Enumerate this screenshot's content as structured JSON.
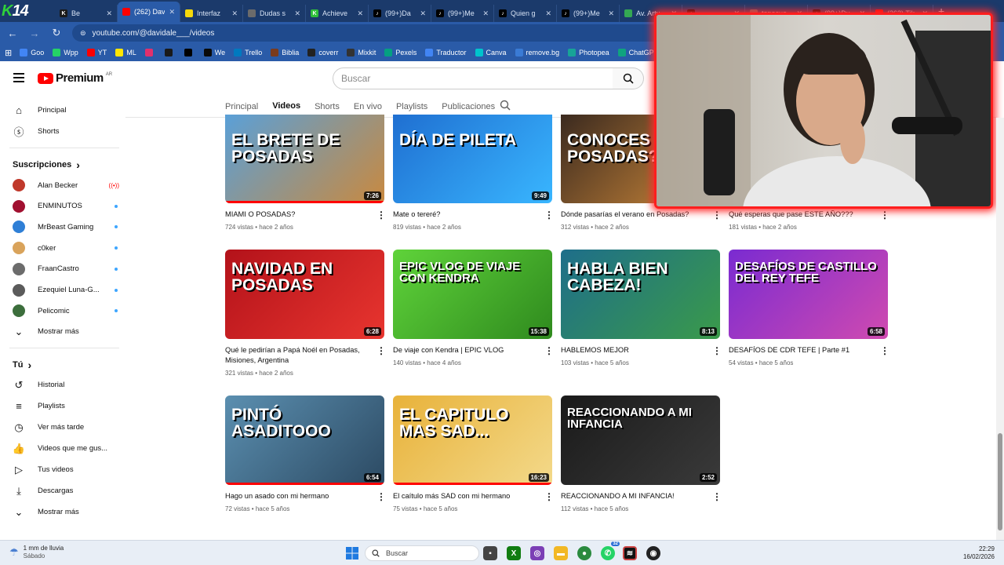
{
  "browser": {
    "tabs": [
      {
        "label": "Be",
        "fav_color": "#1a1a1a",
        "fav_text": "K"
      },
      {
        "label": "(262) Dav",
        "fav_color": "#ff0000",
        "fav_text": "",
        "active": true
      },
      {
        "label": "Interfaz",
        "fav_color": "#f5d90a",
        "fav_text": ""
      },
      {
        "label": "Dudas s",
        "fav_color": "#6b6b6b",
        "fav_text": ""
      },
      {
        "label": "Achieve",
        "fav_color": "#2fbf3a",
        "fav_text": "K"
      },
      {
        "label": "(99+)Da",
        "fav_color": "#000000",
        "fav_text": "♪"
      },
      {
        "label": "(99+)Me",
        "fav_color": "#000000",
        "fav_text": "♪"
      },
      {
        "label": "Quien g",
        "fav_color": "#000000",
        "fav_text": "♪"
      },
      {
        "label": "(99+)Me",
        "fav_color": "#000000",
        "fav_text": "♪"
      },
      {
        "label": "Av. Artu",
        "fav_color": "#34a853",
        "fav_text": ""
      },
      {
        "label": "",
        "fav_color": "#000000",
        "fav_text": "♪"
      },
      {
        "label": "tapecue",
        "fav_color": "#6b6b6b",
        "fav_text": ""
      },
      {
        "label": "(99+)Du",
        "fav_color": "#000000",
        "fav_text": "♪"
      },
      {
        "label": "(262) Tik",
        "fav_color": "#ff0000",
        "fav_text": ""
      }
    ],
    "url": "youtube.com/@davidale___/videos",
    "bookmarks": [
      {
        "label": "Goo",
        "color": "#4285f4"
      },
      {
        "label": "Wpp",
        "color": "#25d366"
      },
      {
        "label": "YT",
        "color": "#ff0000"
      },
      {
        "label": "ML",
        "color": "#ffe600"
      },
      {
        "label": "",
        "color": "#e1306c"
      },
      {
        "label": "",
        "color": "#1a1a1a"
      },
      {
        "label": "",
        "color": "#000000"
      },
      {
        "label": "We",
        "color": "#0a0a0a"
      },
      {
        "label": "Trello",
        "color": "#0079bf"
      },
      {
        "label": "Biblia",
        "color": "#7a3b1e"
      },
      {
        "label": "coverr",
        "color": "#222222"
      },
      {
        "label": "Mixkit",
        "color": "#333333"
      },
      {
        "label": "Pexels",
        "color": "#05a081"
      },
      {
        "label": "Traductor",
        "color": "#4285f4"
      },
      {
        "label": "Canva",
        "color": "#00c4cc"
      },
      {
        "label": "remove.bg",
        "color": "#3a7bd5"
      },
      {
        "label": "Photopea",
        "color": "#18a497"
      },
      {
        "label": "ChatGPT",
        "color": "#10a37f"
      }
    ]
  },
  "header": {
    "brand": "Premium",
    "country": "AR",
    "search_placeholder": "Buscar"
  },
  "channel_tabs": [
    "Principal",
    "Videos",
    "Shorts",
    "En vivo",
    "Playlists",
    "Publicaciones"
  ],
  "active_tab": "Videos",
  "sidebar": {
    "main": [
      {
        "label": "Principal",
        "icon": "home-icon",
        "glyph": "⌂"
      },
      {
        "label": "Shorts",
        "icon": "shorts-icon",
        "glyph": "ⓢ"
      }
    ],
    "subs_header": "Suscripciones",
    "subscriptions": [
      {
        "label": "Alan Becker",
        "color": "#c0392b",
        "status": "live"
      },
      {
        "label": "ENMINUTOS",
        "color": "#a11030",
        "status": "new"
      },
      {
        "label": "MrBeast Gaming",
        "color": "#2f7fd6",
        "status": "new"
      },
      {
        "label": "c0ker",
        "color": "#d9a35b",
        "status": "new"
      },
      {
        "label": "FraanCastro",
        "color": "#6c6c6c",
        "status": "new"
      },
      {
        "label": "Ezequiel Luna-G...",
        "color": "#5b5b5b",
        "status": "new"
      },
      {
        "label": "Pelicomic",
        "color": "#3c6e3c",
        "status": "new"
      }
    ],
    "subs_more": "Mostrar más",
    "you_header": "Tú",
    "you_items": [
      {
        "label": "Historial",
        "icon": "history-icon",
        "glyph": "↺"
      },
      {
        "label": "Playlists",
        "icon": "playlists-icon",
        "glyph": "≡"
      },
      {
        "label": "Ver más tarde",
        "icon": "watch-later-icon",
        "glyph": "◷"
      },
      {
        "label": "Videos que me gus...",
        "icon": "like-icon",
        "glyph": "👍"
      },
      {
        "label": "Tus videos",
        "icon": "your-videos-icon",
        "glyph": "▷"
      },
      {
        "label": "Descargas",
        "icon": "download-icon",
        "glyph": "⤓"
      }
    ],
    "you_more": "Mostrar más"
  },
  "videos": [
    {
      "title": "MIAMI O POSADAS?",
      "meta": "724 vistas • hace 2 años",
      "duration": "7:26",
      "thumb_text": "EL BRETE DE POSADAS",
      "c1": "#5aa0d8",
      "c2": "#c9893f",
      "progress": 1.0
    },
    {
      "title": "Mate o tereré?",
      "meta": "819 vistas • hace 2 años",
      "duration": "9:49",
      "thumb_text": "DÍA DE PILETA",
      "c1": "#1f6fd1",
      "c2": "#39b6ff",
      "progress": 0
    },
    {
      "title": "Dónde pasarías el verano en Posadas?",
      "meta": "312 vistas • hace 2 años",
      "duration": "",
      "thumb_text": "CONOCES POSADAS?",
      "c1": "#3b2a1f",
      "c2": "#d08a3a",
      "progress": 0
    },
    {
      "title": "Qué esperas que pase ESTE AÑO???",
      "meta": "181 vistas • hace 2 años",
      "duration": "",
      "thumb_text": "",
      "c1": "#888888",
      "c2": "#bbbbbb",
      "progress": 0
    },
    {
      "title": "Qué le pedirían a Papá Noél en Posadas, Misiones, Argentina",
      "meta": "321 vistas • hace 2 años",
      "duration": "6:28",
      "thumb_text": "NAVIDAD EN POSADAS",
      "c1": "#b3121a",
      "c2": "#e8352f",
      "progress": 0
    },
    {
      "title": "De viaje con Kendra | EPIC VLOG",
      "meta": "140 vistas • hace 4 años",
      "duration": "15:38",
      "thumb_text": "EPIC VLOG  DE VIAJE CON KENDRA",
      "c1": "#5fd33a",
      "c2": "#2f8a1e",
      "progress": 0
    },
    {
      "title": "HABLEMOS MEJOR",
      "meta": "103 vistas • hace 5 años",
      "duration": "8:13",
      "thumb_text": "HABLA BIEN CABEZA!",
      "c1": "#1e6e8a",
      "c2": "#3a9a4a",
      "progress": 0
    },
    {
      "title": "DESAFÍOS DE CDR TEFE | Parte #1",
      "meta": "54 vistas • hace 5 años",
      "duration": "6:58",
      "thumb_text": "DESAFÍOS DE CASTILLO DEL REY TEFE",
      "c1": "#7a2bd1",
      "c2": "#d04ab0",
      "progress": 0
    },
    {
      "title": "Hago un asado con mi hermano",
      "meta": "72 vistas • hace 5 años",
      "duration": "6:54",
      "thumb_text": "PINTÓ ASADITOOO",
      "c1": "#5b8fb0",
      "c2": "#2c4a63",
      "progress": 1.0
    },
    {
      "title": "El caítulo más SAD con mi hermano",
      "meta": "75 vistas • hace 5 años",
      "duration": "16:23",
      "thumb_text": "EL CAPITULO MAS SAD...",
      "c1": "#e8b23a",
      "c2": "#f3d98a",
      "progress": 1.0
    },
    {
      "title": "REACCIONANDO A MI INFANCIA!",
      "meta": "112 vistas • hace 5 años",
      "duration": "2:52",
      "thumb_text": "REACCIONANDO A MI INFANCIA",
      "c1": "#1a1a1a",
      "c2": "#3a3a3a",
      "progress": 0
    }
  ],
  "taskbar": {
    "weather_line1": "1 mm de lluvia",
    "weather_line2": "Sábado",
    "search_placeholder": "Buscar",
    "time": "22:29",
    "date": "16/02/2026",
    "badge": "32"
  }
}
